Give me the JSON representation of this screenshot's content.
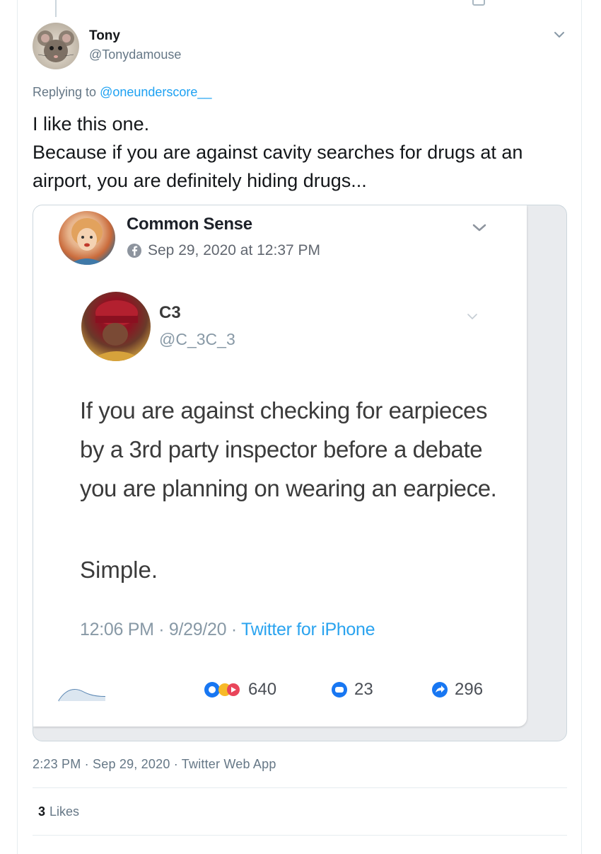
{
  "tweet": {
    "author_name": "Tony",
    "author_handle": "@Tonydamouse",
    "replying_prefix": "Replying to",
    "replying_to": "@oneunderscore__",
    "text_line1": "I like this one.",
    "text_line2": "Because if you are against cavity searches for drugs at an airport, you are definitely hiding drugs...",
    "timestamp": "2:23 PM · Sep 29, 2020 · Twitter Web App",
    "likes_count": "3",
    "likes_label": "Likes"
  },
  "embedded": {
    "page_name": "Common Sense",
    "post_time": "Sep 29, 2020 at 12:37 PM",
    "quoted": {
      "name": "C3",
      "handle": "@C_3C_3",
      "text": "If you are against checking for earpieces by a 3rd party inspector before a debate you are planning on wearing an earpiece.",
      "text2": "Simple.",
      "meta_time": "12:06 PM · 9/29/20 · ",
      "meta_source": "Twitter for iPhone"
    },
    "reactions_count": "640",
    "comments_count": "23",
    "shares_count": "296"
  },
  "colors": {
    "link": "#1da1f2",
    "secondary_text": "#657786",
    "facebook_blue": "#1877f2",
    "border": "#e6ecf0"
  },
  "icons": [
    "mouse-avatar",
    "chevron-down-icon",
    "facebook-globe-icon",
    "like-reaction-icon",
    "comment-icon",
    "share-icon"
  ]
}
